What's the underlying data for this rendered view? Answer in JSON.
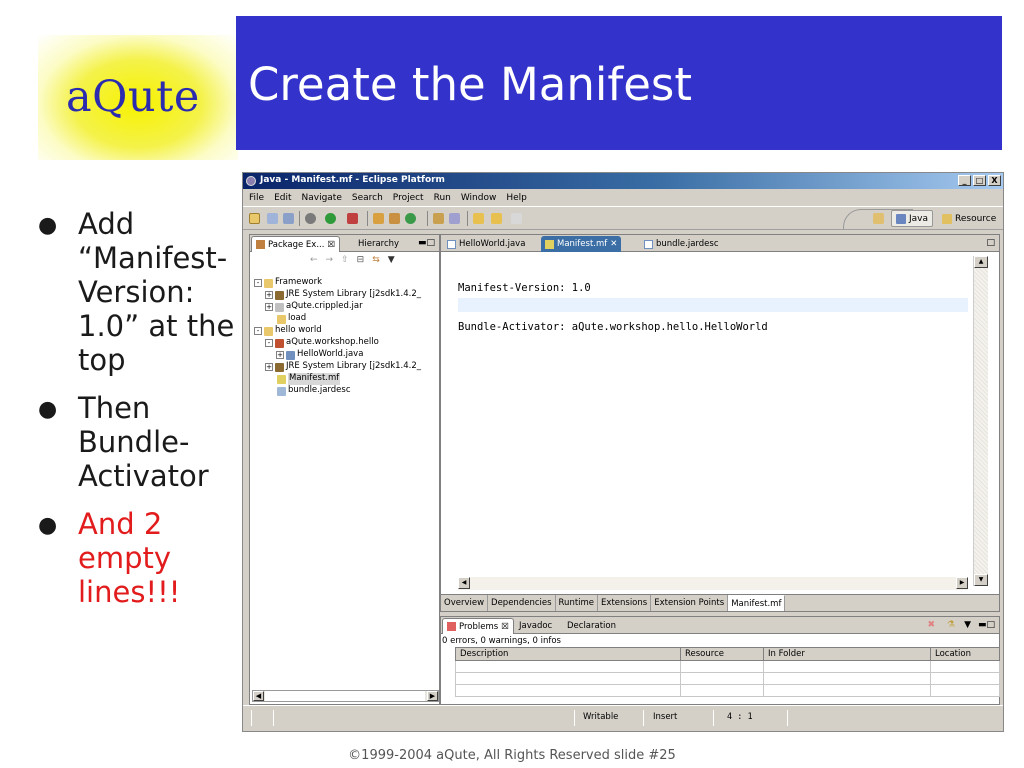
{
  "slide": {
    "logo": "aQute",
    "title": "Create the Manifest",
    "bullets": [
      "Add “Manifest-Version: 1.0” at the top",
      "Then Bundle-Activator",
      "And 2 empty lines!!!"
    ],
    "footer": "©1999-2004 aQute, All Rights Reserved  slide #25",
    "colors": {
      "title_bg": "#3333cc",
      "logo_glow": "#f4f24a",
      "highlight_bullet": "#e21c1c"
    }
  },
  "eclipse": {
    "window_title": "Java - Manifest.mf - Eclipse Platform",
    "window_buttons": [
      "_",
      "□",
      "X"
    ],
    "menu": [
      "File",
      "Edit",
      "Navigate",
      "Search",
      "Project",
      "Run",
      "Window",
      "Help"
    ],
    "perspectives": [
      "Java",
      "Resource"
    ],
    "left_tabs": [
      "Package Ex...",
      "Hierarchy"
    ],
    "tree": [
      {
        "label": "Framework",
        "icon": "folder-icon",
        "sign": "-"
      },
      {
        "label": "JRE System Library [j2sdk1.4.2_",
        "icon": "library-icon",
        "sign": "+"
      },
      {
        "label": "aQute.crippled.jar",
        "icon": "jar-icon",
        "sign": "+"
      },
      {
        "label": "load",
        "icon": "folder-icon",
        "sign": ""
      },
      {
        "label": "hello world",
        "icon": "folder-icon",
        "sign": "-"
      },
      {
        "label": "aQute.workshop.hello",
        "icon": "package-icon",
        "sign": "-"
      },
      {
        "label": "HelloWorld.java",
        "icon": "java-file-icon",
        "sign": "+"
      },
      {
        "label": "JRE System Library [j2sdk1.4.2_",
        "icon": "library-icon",
        "sign": "+"
      },
      {
        "label": "Manifest.mf",
        "icon": "manifest-icon",
        "sign": ""
      },
      {
        "label": "bundle.jardesc",
        "icon": "file-icon",
        "sign": ""
      }
    ],
    "editor_tabs": [
      "HelloWorld.java",
      "Manifest.mf",
      "bundle.jardesc"
    ],
    "code_lines": [
      "Manifest-Version: 1.0",
      "Bundle-Activator: aQute.workshop.hello.HelloWorld"
    ],
    "page_tabs": [
      "Overview",
      "Dependencies",
      "Runtime",
      "Extensions",
      "Extension Points",
      "Manifest.mf"
    ],
    "bottom_tabs": [
      "Problems",
      "Javadoc",
      "Declaration"
    ],
    "problems_summary": "0 errors, 0 warnings, 0 infos",
    "problem_columns": [
      "Description",
      "Resource",
      "In Folder",
      "Location"
    ],
    "status": {
      "writable": "Writable",
      "insert": "Insert",
      "position": "4 : 1"
    }
  }
}
